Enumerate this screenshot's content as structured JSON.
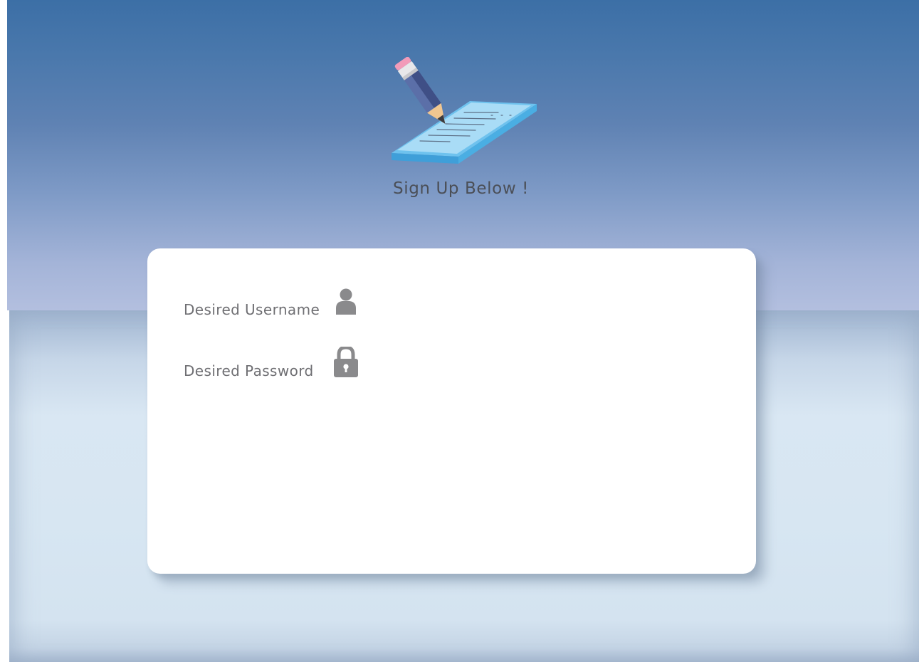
{
  "page": {
    "heading": "Sign Up Below !",
    "logo_icon": "pencil-notepad-icon"
  },
  "form": {
    "username": {
      "label": "Desired Username",
      "icon": "user-icon"
    },
    "password": {
      "label": "Desired Password",
      "icon": "lock-icon"
    }
  },
  "colors": {
    "background_top": "#3c6fa6",
    "background_bottom": "#d7e6f2",
    "card": "#ffffff",
    "label_text": "#6f6f73",
    "icon": "#8a8a8c"
  }
}
